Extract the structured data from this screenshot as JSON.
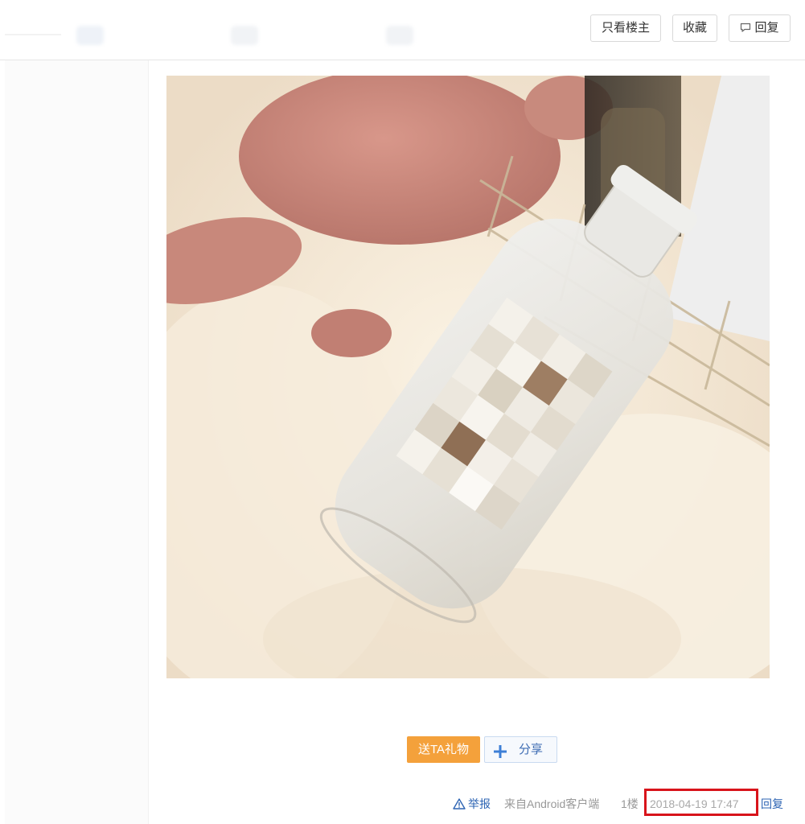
{
  "toolbar": {
    "only_op_label": "只看楼主",
    "favorite_label": "收藏",
    "reply_label": "回复",
    "reply_icon": "comment-icon"
  },
  "post": {
    "image_icon": "photo",
    "gift_label": "送TA礼物",
    "share_label": "分享",
    "share_icon": "plus-icon"
  },
  "footer": {
    "report_icon": "warning-icon",
    "report_label": "举报",
    "source_label": "来自Android客户端",
    "floor_label": "1楼",
    "timestamp": "2018-04-19 17:47",
    "reply_label": "回复"
  },
  "colors": {
    "link": "#2d64b3",
    "gift": "#f4a13b",
    "highlight": "#d8141b"
  }
}
